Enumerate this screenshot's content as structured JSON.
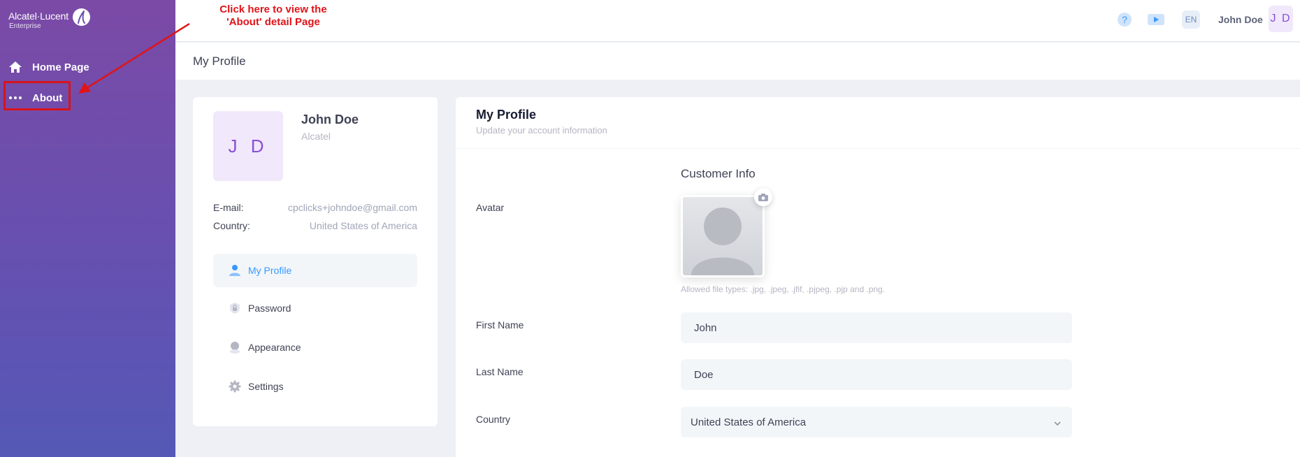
{
  "brand": {
    "name": "Alcatel·Lucent",
    "sub": "Enterprise"
  },
  "sidebar": {
    "items": [
      {
        "label": "Home Page",
        "icon": "home-icon"
      },
      {
        "label": "About",
        "icon": "dots-icon"
      }
    ]
  },
  "annotation": {
    "line1": "Click here to view the",
    "line2": "'About' detail Page",
    "color": "#e0141a"
  },
  "topbar": {
    "lang": "EN",
    "user_name": "John Doe",
    "user_initials": "J D",
    "icons": [
      "help-icon",
      "video-icon"
    ]
  },
  "page": {
    "title": "My Profile"
  },
  "profile_card": {
    "initials": "J D",
    "name": "John Doe",
    "company": "Alcatel",
    "email_label": "E-mail:",
    "email_value": "cpclicks+johndoe@gmail.com",
    "country_label": "Country:",
    "country_value": "United States of America",
    "menu": [
      {
        "label": "My Profile",
        "icon": "user-icon",
        "active": true
      },
      {
        "label": "Password",
        "icon": "lock-icon",
        "active": false
      },
      {
        "label": "Appearance",
        "icon": "appearance-icon",
        "active": false
      },
      {
        "label": "Settings",
        "icon": "gear-icon",
        "active": false
      }
    ]
  },
  "form": {
    "title": "My Profile",
    "subtitle": "Update your account information",
    "section": "Customer Info",
    "avatar_label": "Avatar",
    "allowed_types": "Allowed file types: .jpg, .jpeg, .jfif, .pjpeg, .pjp and .png.",
    "first_name_label": "First Name",
    "first_name_value": "John",
    "last_name_label": "Last Name",
    "last_name_value": "Doe",
    "country_label": "Country",
    "country_value": "United States of America"
  },
  "colors": {
    "accent": "#3699ff",
    "avatar_text": "#8950d6",
    "sidebar_top": "#7b4aa6",
    "sidebar_bottom": "#5558b6"
  }
}
